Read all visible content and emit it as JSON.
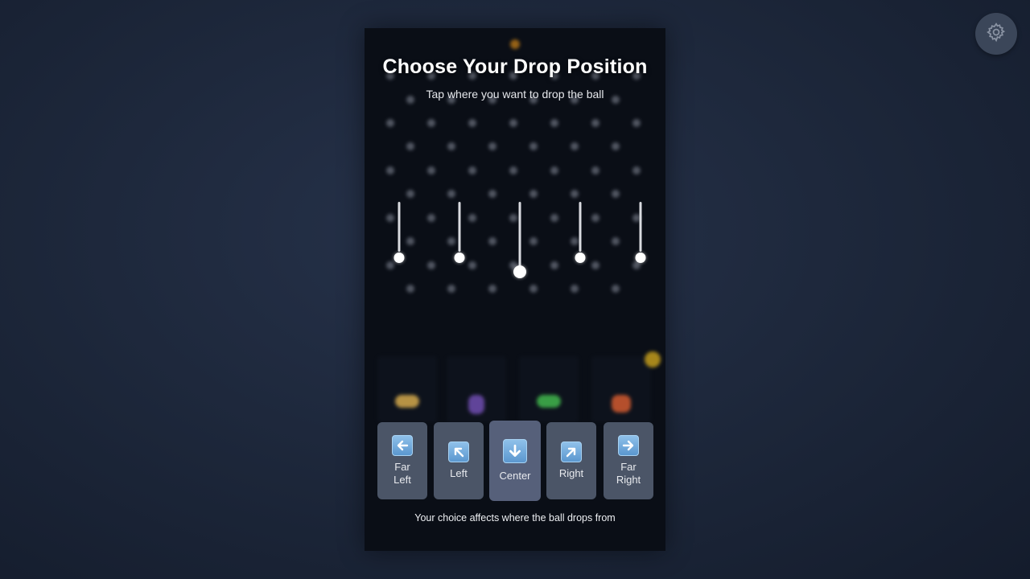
{
  "header": {
    "title": "Choose Your Drop Position",
    "subtitle": "Tap where you want to drop the ball"
  },
  "drop_positions": [
    {
      "label": "Far\nLeft",
      "icon": "arrow-left-icon"
    },
    {
      "label": "Left",
      "icon": "arrow-up-left-icon"
    },
    {
      "label": "Center",
      "icon": "arrow-down-icon",
      "selected": true
    },
    {
      "label": "Right",
      "icon": "arrow-up-right-icon"
    },
    {
      "label": "Far\nRight",
      "icon": "arrow-right-icon"
    }
  ],
  "footer": {
    "note": "Your choice affects where the ball drops from"
  },
  "settings": {
    "icon": "gear-icon"
  },
  "colors": {
    "background": "#1c2639",
    "panel": "#0a0e16",
    "button": "#4b5567",
    "button_selected": "#56607a",
    "arrow_icon": "#6aa6db"
  }
}
